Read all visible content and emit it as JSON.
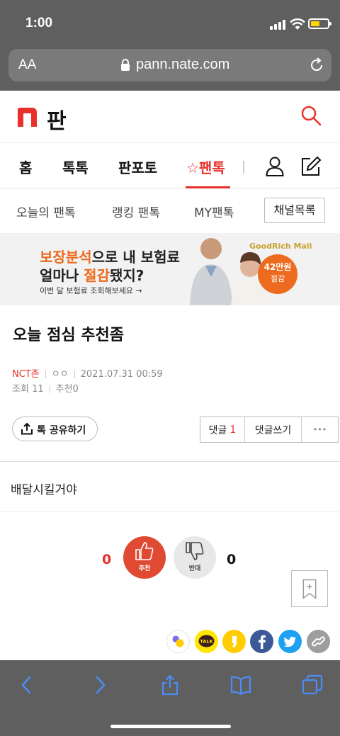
{
  "status_bar": {
    "time": "1:00"
  },
  "browser": {
    "text_size": "AA",
    "url": "pann.nate.com"
  },
  "site": {
    "logo_letter": "n",
    "logo_text": "판"
  },
  "main_tabs": [
    {
      "label": "홈"
    },
    {
      "label": "톡톡"
    },
    {
      "label": "판포토"
    },
    {
      "label": "☆팬톡",
      "active": true
    }
  ],
  "sub_tabs": [
    {
      "label": "오늘의 팬톡"
    },
    {
      "label": "랭킹 팬톡"
    },
    {
      "label": "MY팬톡"
    }
  ],
  "channel_button": "채널목록",
  "banner": {
    "line1_highlight": "보장분석",
    "line1_rest": "으로 내 보험료",
    "line2_prefix": "얼마나 ",
    "line2_highlight": "절감",
    "line2_suffix": "됐지?",
    "line3": "이번 달 보험료 조회해보세요 →",
    "brand": "GoodRich Mall",
    "badge_amount": "42만원",
    "badge_label": "절감"
  },
  "post": {
    "title": "오늘 점심 추천좀",
    "author": "NCT존",
    "masked_name": "ㅇㅇ",
    "date": "2021.07.31 00:59",
    "views_label": "조회",
    "views": "11",
    "recommend_label": "추천",
    "recommend": "0",
    "body": "배달시킬거야"
  },
  "actions": {
    "share": "톡 공유하기",
    "comments_label": "댓글",
    "comments_count": "1",
    "write_comment": "댓글쓰기",
    "more": "•••"
  },
  "votes": {
    "up_count": "0",
    "up_label": "추천",
    "down_label": "반대",
    "down_count": "0"
  },
  "share_icons": [
    "kakaostory-icon",
    "kakaotalk-icon",
    "kakao-channel-icon",
    "facebook-icon",
    "twitter-icon",
    "link-icon"
  ],
  "colors": {
    "accent": "#e8302a",
    "banner_orange": "#ec6b1e",
    "facebook": "#3b5998",
    "twitter": "#1da1f2"
  }
}
